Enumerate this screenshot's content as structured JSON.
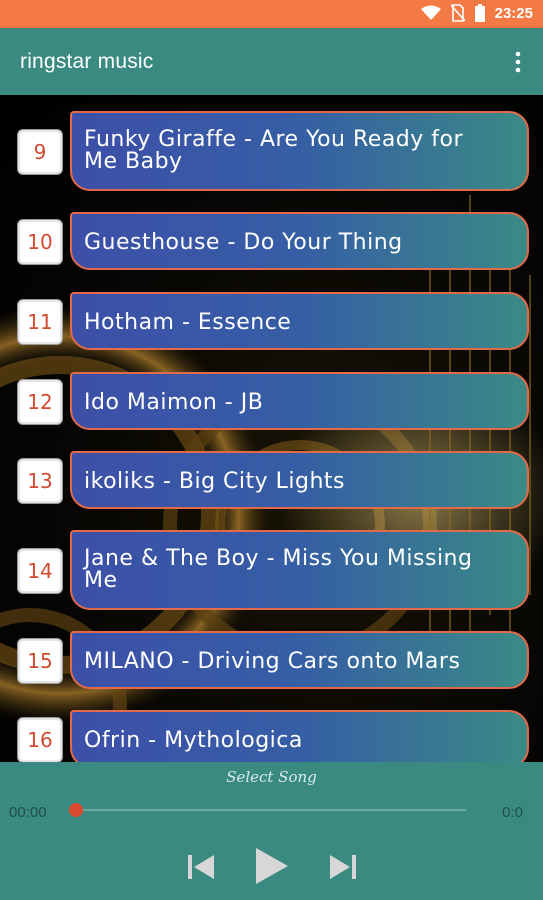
{
  "status_bar": {
    "time": "23:25",
    "icons": [
      "wifi-icon",
      "no-sim-icon",
      "battery-icon"
    ]
  },
  "app_bar": {
    "title": "ringstar music",
    "menu_icon": "overflow-menu-icon"
  },
  "songs": [
    {
      "number": "9",
      "title_lines": [
        "Funky Giraffe - Are You Ready for",
        "Me Baby"
      ]
    },
    {
      "number": "10",
      "title_lines": [
        "Guesthouse - Do Your Thing"
      ]
    },
    {
      "number": "11",
      "title_lines": [
        "Hotham - Essence"
      ]
    },
    {
      "number": "12",
      "title_lines": [
        "Ido Maimon - JB"
      ]
    },
    {
      "number": "13",
      "title_lines": [
        "ikoliks - Big City Lights"
      ]
    },
    {
      "number": "14",
      "title_lines": [
        "Jane & The Boy - Miss You Missing",
        "Me"
      ]
    },
    {
      "number": "15",
      "title_lines": [
        "MILANO - Driving Cars onto Mars"
      ]
    },
    {
      "number": "16",
      "title_lines": [
        "Ofrin - Mythologica"
      ]
    }
  ],
  "player": {
    "now_playing": "Select Song",
    "elapsed": "00:00",
    "duration": "0:0",
    "progress": 0,
    "controls": [
      "previous-icon",
      "play-icon",
      "next-icon"
    ]
  },
  "colors": {
    "status_bar": "#f37a45",
    "app_bar": "#3a8a82",
    "player": "#3a8a82",
    "pill_border": "#e26a4a",
    "number_text": "#d24a2f",
    "seek_thumb": "#d84b2f"
  }
}
